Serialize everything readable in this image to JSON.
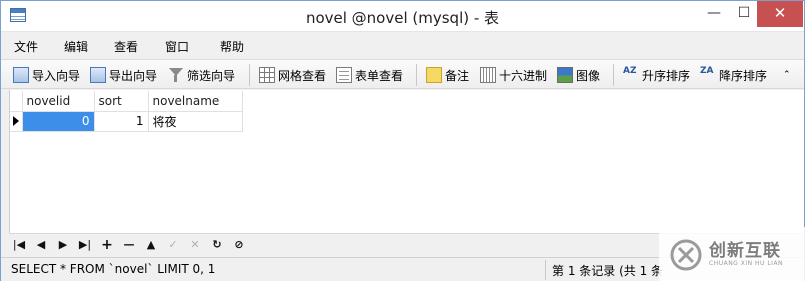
{
  "window": {
    "title": "novel @novel (mysql) - 表",
    "minimize_glyph": "—",
    "maximize_glyph": "☐",
    "close_glyph": "✕"
  },
  "menu": [
    "文件",
    "编辑",
    "查看",
    "窗口",
    "帮助"
  ],
  "toolbar": {
    "import_wizard": "导入向导",
    "export_wizard": "导出向导",
    "filter_wizard": "筛选向导",
    "grid_view": "网格查看",
    "form_view": "表单查看",
    "memo": "备注",
    "hex": "十六进制",
    "image": "图像",
    "sort_asc": "升序排序",
    "sort_desc": "降序排序",
    "sort_asc_icon_text": "AZ",
    "sort_desc_icon_text": "ZA",
    "overflow_glyph": "⌃"
  },
  "grid": {
    "columns": [
      "novelid",
      "sort",
      "novelname"
    ],
    "rows": [
      {
        "novelid": "0",
        "sort": "1",
        "novelname": "将夜"
      }
    ]
  },
  "nav": {
    "first": "|◀",
    "prev": "◀",
    "next": "▶",
    "last": "▶|",
    "add": "+",
    "delete": "—",
    "up": "▲",
    "check": "✓",
    "cancel": "✕",
    "refresh": "↻",
    "stop": "⊘"
  },
  "status": {
    "sql": "SELECT * FROM `novel` LIMIT 0, 1",
    "record": "第 1 条记录 (共 1 条"
  },
  "watermark": {
    "cn": "创新互联",
    "en": "CHUANG XIN HU LIAN"
  }
}
